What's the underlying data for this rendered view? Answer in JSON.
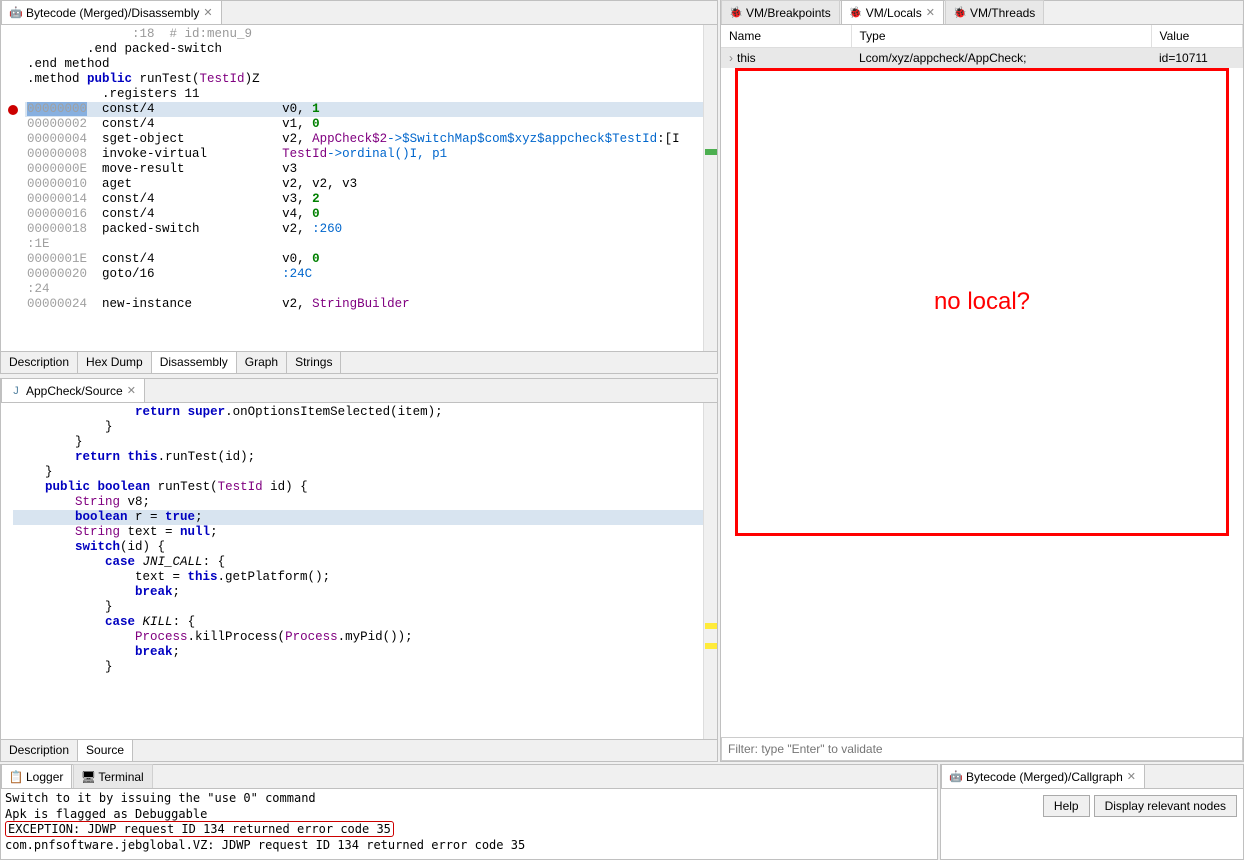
{
  "disassembly": {
    "tabLabel": "Bytecode (Merged)/Disassembly",
    "lines": [
      {
        "addr": null,
        "indent": 14,
        "text": ":18  # id:menu_9",
        "cls": "comment"
      },
      {
        "addr": null,
        "indent": 8,
        "opcode": ".end packed-switch"
      },
      {
        "addr": null,
        "indent": 0,
        "opcode": ".end method"
      },
      {
        "addr": null,
        "indent": 0,
        "text": ""
      },
      {
        "addr": null,
        "indent": 0,
        "method": ".method public runTest(TestId)Z",
        "sig": true
      },
      {
        "addr": null,
        "indent": 10,
        "opcode": ".registers 11"
      },
      {
        "addr": "00000000",
        "opcode": "const/4",
        "args": "v0, ",
        "num": "1",
        "hl": "exec",
        "bp": true
      },
      {
        "addr": "00000002",
        "opcode": "const/4",
        "args": "v1, ",
        "num": "0"
      },
      {
        "addr": "00000004",
        "opcode": "sget-object",
        "args": "v2, ",
        "type": "AppCheck$2",
        "rest": "->$SwitchMap$com$xyz$appcheck$TestId",
        "suffix": ":[I"
      },
      {
        "addr": "00000008",
        "opcode": "invoke-virtual",
        "args": "",
        "type": "TestId",
        "rest": "->ordinal()I, p1"
      },
      {
        "addr": "0000000E",
        "opcode": "move-result",
        "args": "v3"
      },
      {
        "addr": "00000010",
        "opcode": "aget",
        "args": "v2, v2, v3"
      },
      {
        "addr": "00000014",
        "opcode": "const/4",
        "args": "v3, ",
        "num": "2"
      },
      {
        "addr": "00000016",
        "opcode": "const/4",
        "args": "v4, ",
        "num": "0"
      },
      {
        "addr": "00000018",
        "opcode": "packed-switch",
        "args": "v2, ",
        "rest": ":260"
      },
      {
        "addr": null,
        "indent": 0,
        "text": ":1E",
        "cls": "addr"
      },
      {
        "addr": "0000001E",
        "opcode": "const/4",
        "args": "v0, ",
        "num": "0"
      },
      {
        "addr": "00000020",
        "opcode": "goto/16",
        "args": "",
        "rest": ":24C"
      },
      {
        "addr": null,
        "indent": 0,
        "text": ":24",
        "cls": "addr"
      },
      {
        "addr": "00000024",
        "opcode": "new-instance",
        "args": "v2, ",
        "type": "StringBuilder"
      }
    ],
    "bottomTabs": [
      "Description",
      "Hex Dump",
      "Disassembly",
      "Graph",
      "Strings"
    ],
    "activeBottomTab": 2
  },
  "source": {
    "tabLabel": "AppCheck/Source",
    "code": [
      "                return super.onOptionsItemSelected(item);",
      "            }",
      "        }",
      "",
      "        return this.runTest(id);",
      "    }",
      "",
      "    public boolean runTest(TestId id) {",
      "        String v8;",
      "        boolean r = true;",
      "        String text = null;",
      "        switch(id) {",
      "            case JNI_CALL: {",
      "                text = this.getPlatform();",
      "                break;",
      "            }",
      "            case KILL: {",
      "                Process.killProcess(Process.myPid());",
      "                break;",
      "            }"
    ],
    "highlightLine": 9,
    "bottomTabs": [
      "Description",
      "Source"
    ],
    "activeBottomTab": 1
  },
  "vmTabs": {
    "tabs": [
      "VM/Breakpoints",
      "VM/Locals",
      "VM/Threads"
    ],
    "activeTab": 1
  },
  "locals": {
    "columns": [
      "Name",
      "Type",
      "Value"
    ],
    "rows": [
      {
        "name": "this",
        "type": "Lcom/xyz/appcheck/AppCheck;",
        "value": "id=10711",
        "expandable": true
      }
    ],
    "filterPlaceholder": "Filter: type \"Enter\" to validate",
    "annotation": "no local?"
  },
  "logger": {
    "tabs": [
      "Logger",
      "Terminal"
    ],
    "activeTab": 0,
    "lines": [
      "Switch to it by issuing the \"use 0\" command",
      "Apk is flagged as Debuggable",
      "EXCEPTION: JDWP request ID 134 returned error code 35",
      "com.pnfsoftware.jebglobal.VZ: JDWP request ID 134 returned error code 35"
    ],
    "errorLine": 2
  },
  "callgraph": {
    "tabLabel": "Bytecode (Merged)/Callgraph",
    "buttons": [
      "Help",
      "Display relevant nodes"
    ]
  }
}
